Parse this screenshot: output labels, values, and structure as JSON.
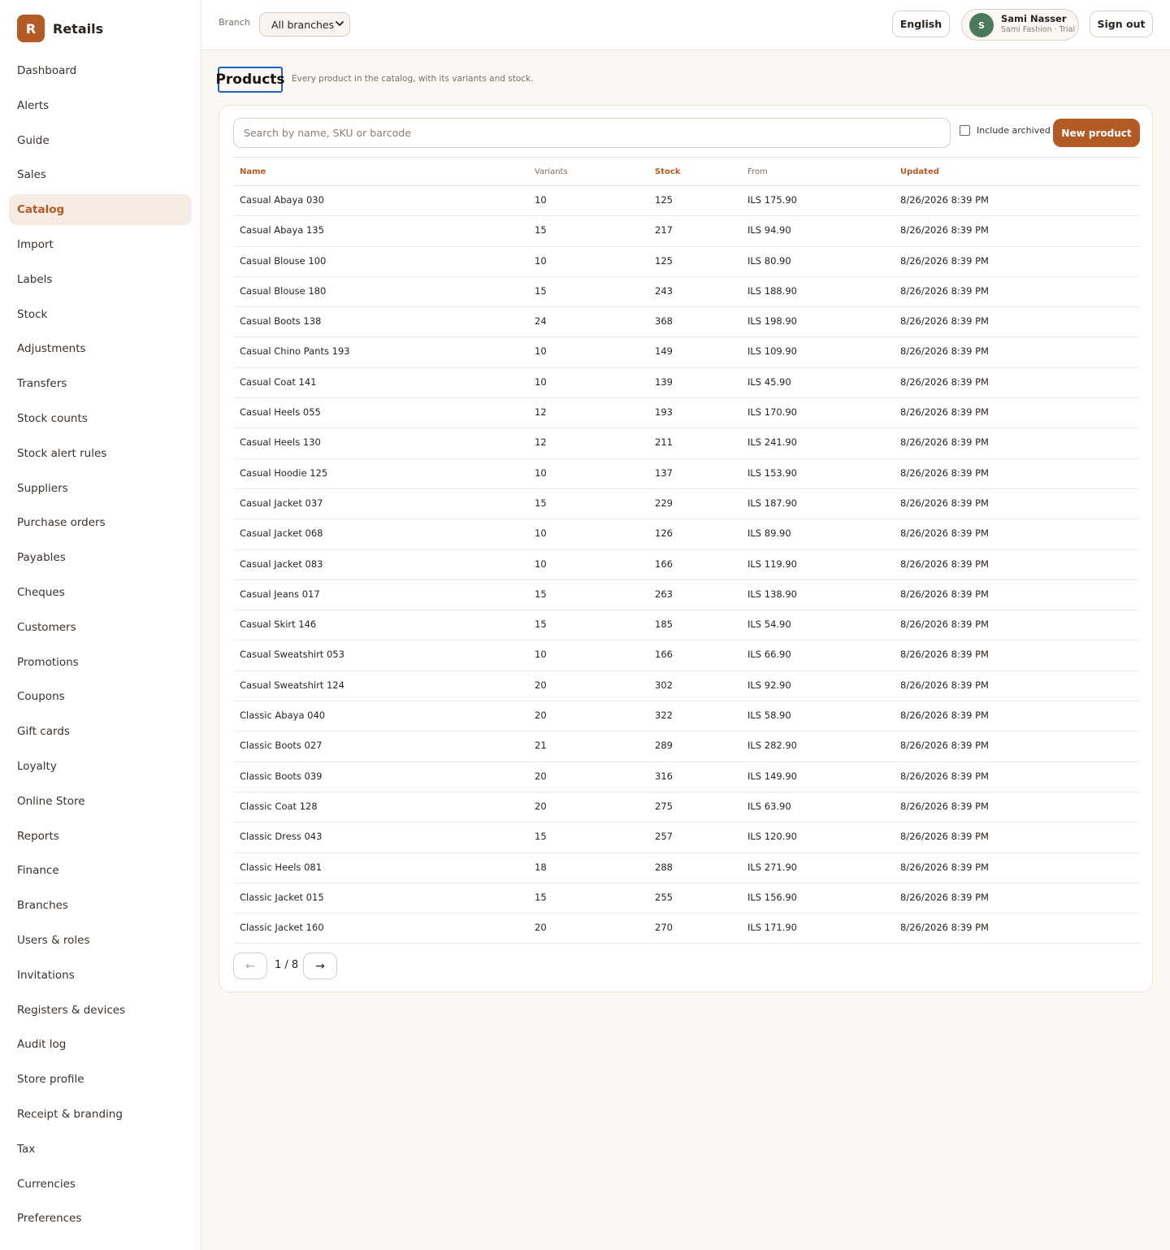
{
  "brand": {
    "logo_letter": "R",
    "name": "Retails",
    "accent": "#b45a25"
  },
  "nav": [
    {
      "label": "Dashboard"
    },
    {
      "label": "Alerts"
    },
    {
      "label": "Guide"
    },
    {
      "label": "Sales"
    },
    {
      "label": "Catalog",
      "active": true
    },
    {
      "label": "Import"
    },
    {
      "label": "Labels"
    },
    {
      "label": "Stock"
    },
    {
      "label": "Adjustments"
    },
    {
      "label": "Transfers"
    },
    {
      "label": "Stock counts"
    },
    {
      "label": "Stock alert rules"
    },
    {
      "label": "Suppliers"
    },
    {
      "label": "Purchase orders"
    },
    {
      "label": "Payables"
    },
    {
      "label": "Cheques"
    },
    {
      "label": "Customers"
    },
    {
      "label": "Promotions"
    },
    {
      "label": "Coupons"
    },
    {
      "label": "Gift cards"
    },
    {
      "label": "Loyalty"
    },
    {
      "label": "Online Store"
    },
    {
      "label": "Reports"
    },
    {
      "label": "Finance"
    },
    {
      "label": "Branches"
    },
    {
      "label": "Users & roles"
    },
    {
      "label": "Invitations"
    },
    {
      "label": "Registers & devices"
    },
    {
      "label": "Audit log"
    },
    {
      "label": "Store profile"
    },
    {
      "label": "Receipt & branding"
    },
    {
      "label": "Tax"
    },
    {
      "label": "Currencies"
    },
    {
      "label": "Preferences"
    }
  ],
  "topbar": {
    "branch_label": "Branch",
    "branch_value": "All branches",
    "language": "English",
    "user": {
      "initial": "S",
      "name": "Sami Nasser",
      "subtitle": "Sami Fashion · Trial"
    },
    "sign_out": "Sign out"
  },
  "page": {
    "title": "Products",
    "subtitle": "Every product in the catalog, with its variants and stock."
  },
  "toolbar": {
    "search_placeholder": "Search by name, SKU or barcode",
    "include_archived": "Include archived",
    "new_product": "New product"
  },
  "table": {
    "columns": [
      {
        "label": "Name",
        "sortable": true
      },
      {
        "label": "Variants",
        "sortable": false
      },
      {
        "label": "Stock",
        "sortable": true
      },
      {
        "label": "From",
        "sortable": false
      },
      {
        "label": "Updated",
        "sortable": true
      }
    ],
    "rows": [
      [
        "Casual Abaya 030",
        "10",
        "125",
        "ILS 175.90",
        "8/26/2026 8:39 PM"
      ],
      [
        "Casual Abaya 135",
        "15",
        "217",
        "ILS 94.90",
        "8/26/2026 8:39 PM"
      ],
      [
        "Casual Blouse 100",
        "10",
        "125",
        "ILS 80.90",
        "8/26/2026 8:39 PM"
      ],
      [
        "Casual Blouse 180",
        "15",
        "243",
        "ILS 188.90",
        "8/26/2026 8:39 PM"
      ],
      [
        "Casual Boots 138",
        "24",
        "368",
        "ILS 198.90",
        "8/26/2026 8:39 PM"
      ],
      [
        "Casual Chino Pants 193",
        "10",
        "149",
        "ILS 109.90",
        "8/26/2026 8:39 PM"
      ],
      [
        "Casual Coat 141",
        "10",
        "139",
        "ILS 45.90",
        "8/26/2026 8:39 PM"
      ],
      [
        "Casual Heels 055",
        "12",
        "193",
        "ILS 170.90",
        "8/26/2026 8:39 PM"
      ],
      [
        "Casual Heels 130",
        "12",
        "211",
        "ILS 241.90",
        "8/26/2026 8:39 PM"
      ],
      [
        "Casual Hoodie 125",
        "10",
        "137",
        "ILS 153.90",
        "8/26/2026 8:39 PM"
      ],
      [
        "Casual Jacket 037",
        "15",
        "229",
        "ILS 187.90",
        "8/26/2026 8:39 PM"
      ],
      [
        "Casual Jacket 068",
        "10",
        "126",
        "ILS 89.90",
        "8/26/2026 8:39 PM"
      ],
      [
        "Casual Jacket 083",
        "10",
        "166",
        "ILS 119.90",
        "8/26/2026 8:39 PM"
      ],
      [
        "Casual Jeans 017",
        "15",
        "263",
        "ILS 138.90",
        "8/26/2026 8:39 PM"
      ],
      [
        "Casual Skirt 146",
        "15",
        "185",
        "ILS 54.90",
        "8/26/2026 8:39 PM"
      ],
      [
        "Casual Sweatshirt 053",
        "10",
        "166",
        "ILS 66.90",
        "8/26/2026 8:39 PM"
      ],
      [
        "Casual Sweatshirt 124",
        "20",
        "302",
        "ILS 92.90",
        "8/26/2026 8:39 PM"
      ],
      [
        "Classic Abaya 040",
        "20",
        "322",
        "ILS 58.90",
        "8/26/2026 8:39 PM"
      ],
      [
        "Classic Boots 027",
        "21",
        "289",
        "ILS 282.90",
        "8/26/2026 8:39 PM"
      ],
      [
        "Classic Boots 039",
        "20",
        "316",
        "ILS 149.90",
        "8/26/2026 8:39 PM"
      ],
      [
        "Classic Coat 128",
        "20",
        "275",
        "ILS 63.90",
        "8/26/2026 8:39 PM"
      ],
      [
        "Classic Dress 043",
        "15",
        "257",
        "ILS 120.90",
        "8/26/2026 8:39 PM"
      ],
      [
        "Classic Heels 081",
        "18",
        "288",
        "ILS 271.90",
        "8/26/2026 8:39 PM"
      ],
      [
        "Classic Jacket 015",
        "15",
        "255",
        "ILS 156.90",
        "8/26/2026 8:39 PM"
      ],
      [
        "Classic Jacket 160",
        "20",
        "270",
        "ILS 171.90",
        "8/26/2026 8:39 PM"
      ]
    ]
  },
  "pager": {
    "prev": "←",
    "next": "→",
    "text": "1 / 8"
  }
}
